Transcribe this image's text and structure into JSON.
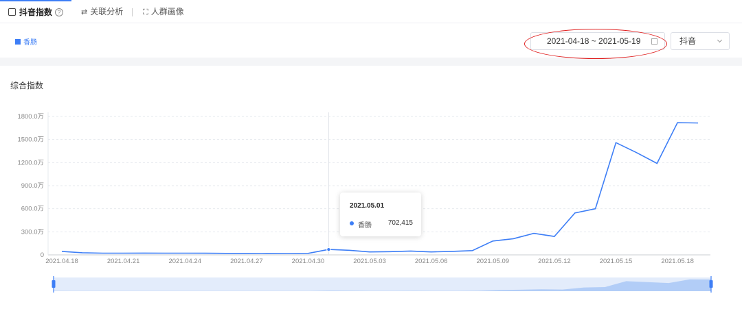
{
  "tabs": [
    {
      "label": "抖音指数",
      "active": true
    },
    {
      "label": "关联分析",
      "active": false
    },
    {
      "label": "人群画像",
      "active": false
    }
  ],
  "help_label": "?",
  "keyword_label": "香肠",
  "date_range": "2021-04-18 ~ 2021-05-19",
  "platform_select": "抖音",
  "chart_title": "综合指数",
  "chart_data": {
    "type": "line",
    "title": "综合指数",
    "xlabel": "",
    "ylabel": "",
    "ylim": [
      0,
      1800
    ],
    "y_unit": "万",
    "y_ticks": [
      "0",
      "300.0万",
      "600.0万",
      "900.0万",
      "1200.0万",
      "1500.0万",
      "1800.0万"
    ],
    "x_ticks": [
      "2021.04.18",
      "2021.04.21",
      "2021.04.24",
      "2021.04.27",
      "2021.04.30",
      "2021.05.03",
      "2021.05.06",
      "2021.05.09",
      "2021.05.12",
      "2021.05.15",
      "2021.05.18"
    ],
    "x": [
      "2021.04.18",
      "2021.04.19",
      "2021.04.20",
      "2021.04.21",
      "2021.04.22",
      "2021.04.23",
      "2021.04.24",
      "2021.04.25",
      "2021.04.26",
      "2021.04.27",
      "2021.04.28",
      "2021.04.29",
      "2021.04.30",
      "2021.05.01",
      "2021.05.02",
      "2021.05.03",
      "2021.05.04",
      "2021.05.05",
      "2021.05.06",
      "2021.05.07",
      "2021.05.08",
      "2021.05.09",
      "2021.05.10",
      "2021.05.11",
      "2021.05.12",
      "2021.05.13",
      "2021.05.14",
      "2021.05.15",
      "2021.05.16",
      "2021.05.17",
      "2021.05.18",
      "2021.05.19"
    ],
    "series": [
      {
        "name": "香肠",
        "color": "#3d7ef6",
        "values": [
          45,
          28,
          22,
          22,
          23,
          22,
          22,
          21,
          20,
          20,
          19,
          18,
          20,
          70.2415,
          60,
          38,
          42,
          50,
          38,
          45,
          55,
          180,
          210,
          280,
          240,
          545,
          600,
          1460,
          1330,
          1190,
          1720,
          1715
        ]
      }
    ],
    "grid": true,
    "highlight_index": 13
  },
  "tooltip": {
    "date": "2021.05.01",
    "series_name": "香肠",
    "value": "702,415"
  }
}
